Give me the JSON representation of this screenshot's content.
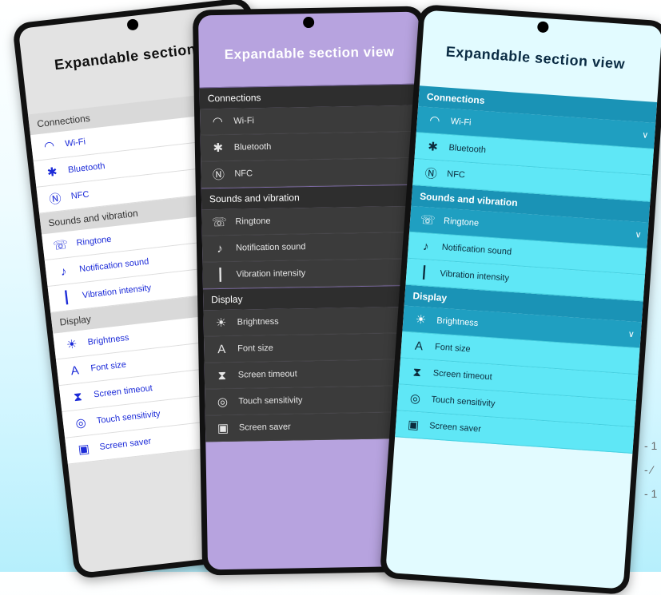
{
  "title": "Expandable section view",
  "title_truncated_left": "Expandable section",
  "title_truncated_mid": "Expandable section view",
  "sections": [
    {
      "header": "Connections",
      "items": [
        {
          "label": "Wi-Fi",
          "icon": "wifi-icon"
        },
        {
          "label": "Bluetooth",
          "icon": "bluetooth-icon"
        },
        {
          "label": "NFC",
          "icon": "nfc-icon"
        }
      ]
    },
    {
      "header": "Sounds and vibration",
      "items": [
        {
          "label": "Ringtone",
          "icon": "ringtone-icon"
        },
        {
          "label": "Notification sound",
          "icon": "bell-icon"
        },
        {
          "label": "Vibration intensity",
          "icon": "vibration-icon"
        }
      ]
    },
    {
      "header": "Display",
      "items": [
        {
          "label": "Brightness",
          "icon": "brightness-icon"
        },
        {
          "label": "Font size",
          "icon": "font-size-icon"
        },
        {
          "label": "Screen timeout",
          "icon": "hourglass-icon"
        },
        {
          "label": "Touch sensitivity",
          "icon": "touch-icon"
        },
        {
          "label": "Screen saver",
          "icon": "screen-saver-icon"
        }
      ]
    }
  ],
  "side_text": [
    "- 1",
    "- ⁄",
    "- 1"
  ],
  "colors": {
    "light_accent": "#1c2bd8",
    "purple_header": "#b7a3df",
    "dark_row": "#3b3b3b",
    "cyan_header": "#1a93b6",
    "cyan_row": "#5fe7f6"
  }
}
